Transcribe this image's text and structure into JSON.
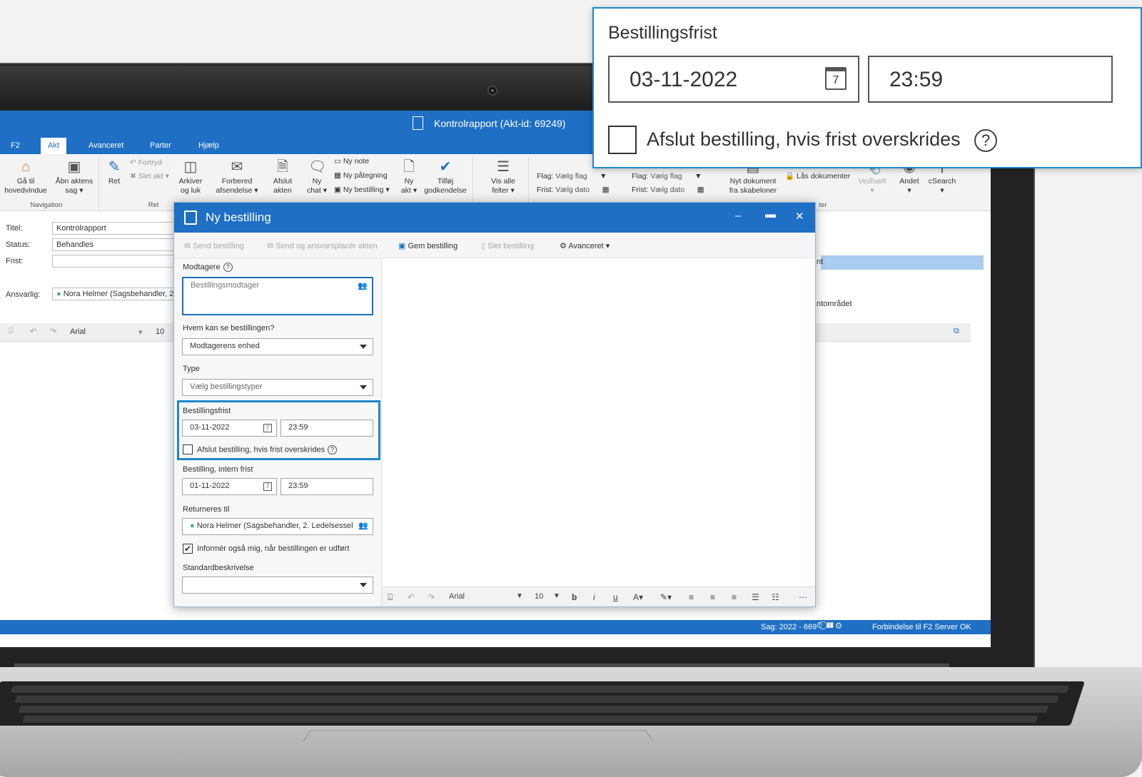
{
  "window": {
    "title": "Kontrolrapport (Akt-id: 69249)"
  },
  "ribbon": {
    "tabs": [
      "F2",
      "Akt",
      "Avanceret",
      "Parter",
      "Hjælp"
    ],
    "buttons": {
      "home_line1": "Gå til",
      "home_line2": "hovedvindue",
      "case_line1": "Åbn aktens",
      "case_line2": "sag",
      "edit": "Ret",
      "undo": "Fortryd",
      "delete": "Slet akt",
      "archive_line1": "Arkiver",
      "archive_line2": "og luk",
      "prepare_line1": "Forbered",
      "prepare_line2": "afsendelse",
      "close_line1": "Afslut",
      "close_line2": "akten",
      "chat_line1": "Ny",
      "chat_line2": "chat",
      "new_note": "Ny note",
      "new_annotation": "Ny påtegning",
      "new_order": "Ny bestilling",
      "new_record_line1": "Ny",
      "new_record_line2": "akt",
      "approve_line1": "Tilføj",
      "approve_line2": "godkendelse",
      "show_fields_line1": "Vis alle",
      "show_fields_line2": "felter",
      "flag_label": "Flag:",
      "flag_value": "Vælg flag",
      "deadline_label": "Frist:",
      "deadline_value": "Vælg dato",
      "new_doc_line1": "Nyt dokument",
      "new_doc_line2": "fra skabeloner",
      "lock_docs": "Lås dokumenter",
      "attach": "Vedhæft",
      "other": "Andet",
      "csearch": "cSearch"
    },
    "groups": {
      "navigation": "Navigation",
      "edit": "Ret",
      "ter": "ter"
    }
  },
  "meta": {
    "title_label": "Titel:",
    "title_value": "Kontrolrapport",
    "status_label": "Status:",
    "status_value": "Behandles",
    "deadline_label": "Frist:",
    "responsible_label": "Ansvarlig:",
    "responsible_value": "Nora Helmer (Sagsbehandler, 2."
  },
  "editor": {
    "font": "Arial",
    "size": "10"
  },
  "right_panel": {
    "highlight": "nt",
    "area": "ntområdet"
  },
  "statusbar": {
    "case": "Sag: 2022 - 669",
    "connection": "Forbindelse til F2 Server OK"
  },
  "dialog": {
    "title": "Ny bestilling",
    "toolbar": {
      "send": "Send bestilling",
      "send_assign": "Send og ansvarsplacér akten",
      "save": "Gem bestilling",
      "delete": "Slet bestilling",
      "advanced": "Avanceret"
    },
    "recipients_label": "Modtagere",
    "recipients_placeholder": "Bestillingsmodtager",
    "visibility_label": "Hvem kan se bestillingen?",
    "visibility_value": "Modtagerens enhed",
    "type_label": "Type",
    "type_value": "Vælg bestillingstyper",
    "deadline_label": "Bestillingsfrist",
    "deadline_date": "03-11-2022",
    "deadline_time": "23:59",
    "close_on_deadline": "Afslut bestilling, hvis frist overskrides",
    "internal_deadline_label": "Bestilling, intern frist",
    "internal_date": "01-11-2022",
    "internal_time": "23:59",
    "return_label": "Returneres til",
    "return_value": "Nora Helmer (Sagsbehandler, 2. Ledelsessel",
    "inform_me": "Informér også mig, når bestillingen er udført",
    "inform_checked": true,
    "standard_label": "Standardbeskrivelse",
    "editor_font": "Arial",
    "editor_size": "10"
  },
  "zoom": {
    "label": "Bestillingsfrist",
    "date": "03-11-2022",
    "time": "23:59",
    "checkbox_label": "Afslut bestilling, hvis frist overskrides"
  },
  "colors": {
    "accent": "#1f6fc5",
    "highlight_border": "#1f88c9",
    "status_green": "#4caf7d"
  }
}
